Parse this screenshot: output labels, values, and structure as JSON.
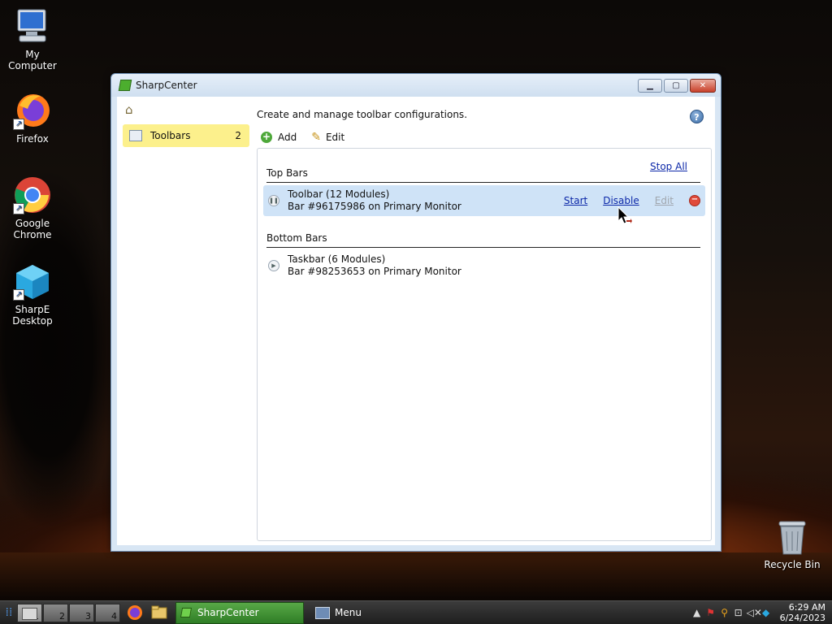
{
  "desktop": {
    "icons": [
      {
        "label": "My Computer"
      },
      {
        "label": "Firefox"
      },
      {
        "label": "Google Chrome"
      },
      {
        "label": "SharpE Desktop"
      },
      {
        "label": "Recycle Bin"
      }
    ]
  },
  "window": {
    "title": "SharpCenter",
    "sidebar": {
      "items": [
        {
          "label": "Toolbars",
          "count": "2"
        }
      ]
    },
    "description": "Create and manage toolbar configurations.",
    "actions": {
      "add_label": "Add",
      "edit_label": "Edit"
    },
    "sections": {
      "top": {
        "title": "Top Bars",
        "stop_all": "Stop All",
        "bars": [
          {
            "name": "Toolbar (12 Modules)",
            "detail": "Bar #96175986 on Primary Monitor",
            "start": "Start",
            "disable": "Disable",
            "edit": "Edit"
          }
        ]
      },
      "bottom": {
        "title": "Bottom Bars",
        "bars": [
          {
            "name": "Taskbar (6 Modules)",
            "detail": "Bar #98253653 on Primary Monitor"
          }
        ]
      }
    }
  },
  "taskbar": {
    "desktops": [
      "1",
      "2",
      "3",
      "4"
    ],
    "task_label": "SharpCenter",
    "menu_label": "Menu",
    "clock": {
      "time": "6:29 AM",
      "date": "6/24/2023"
    }
  },
  "colors": {
    "accent_link": "#0b27a8",
    "sidebar_highlight": "#fcf08c",
    "selected_row": "#cfe3f7",
    "task_button": "#3f9233"
  }
}
